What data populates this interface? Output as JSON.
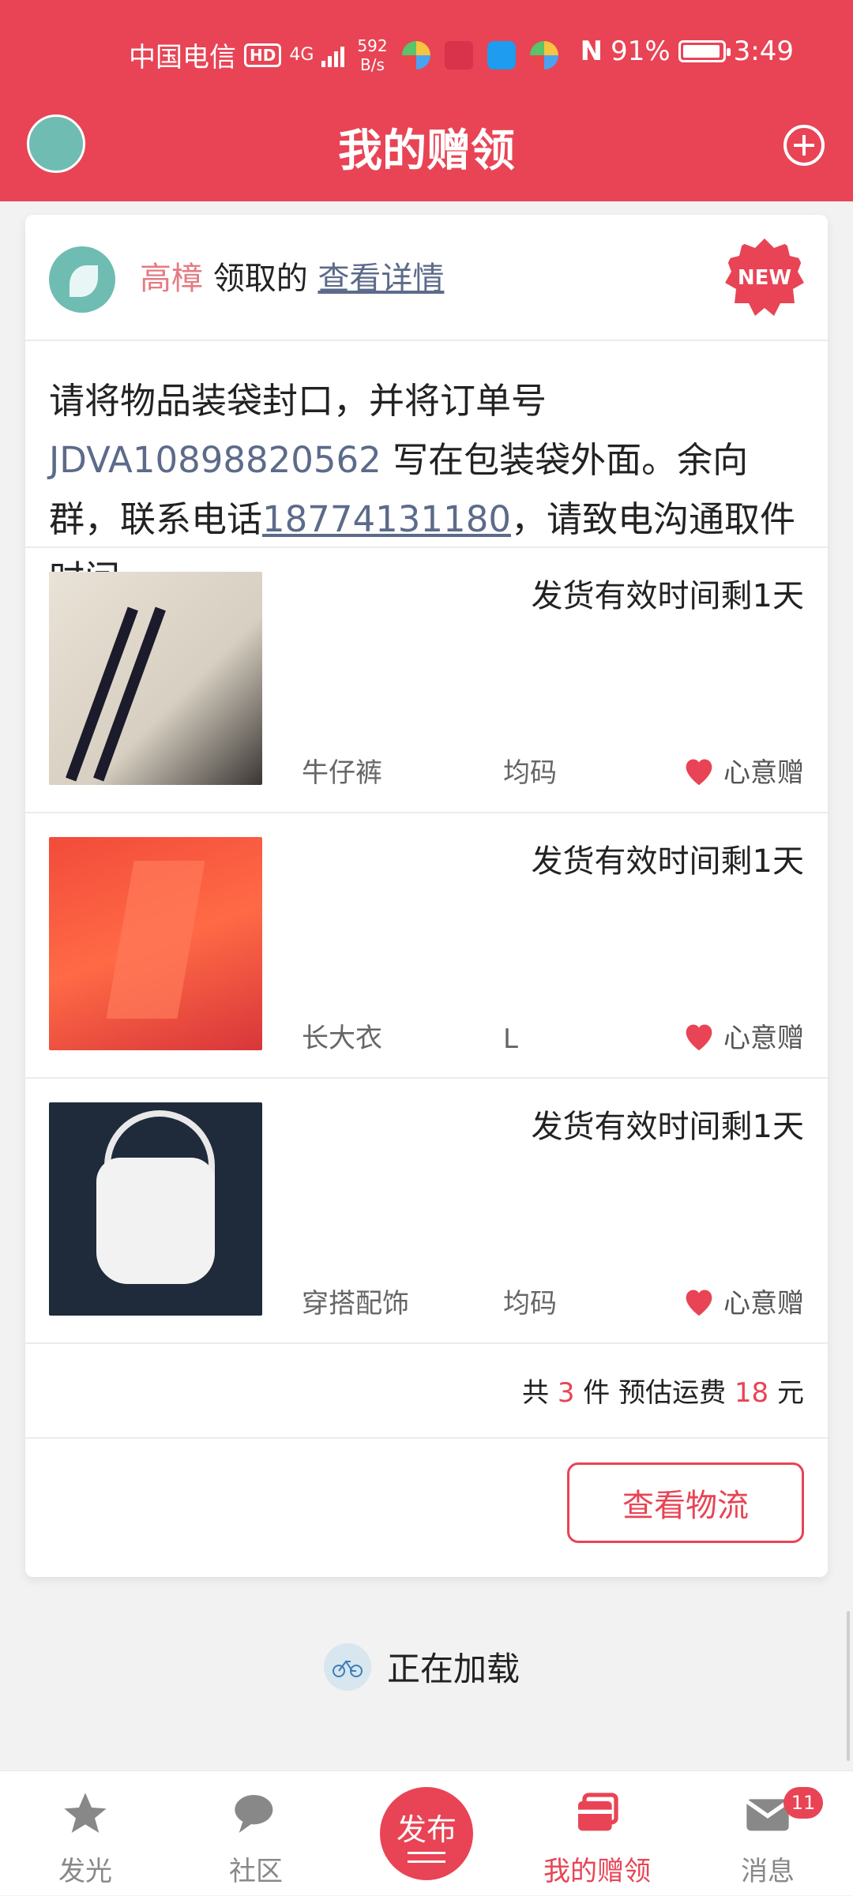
{
  "statusbar": {
    "carrier": "中国电信",
    "hd": "HD",
    "net": "4G",
    "speed_top": "592",
    "speed_bottom": "B/s",
    "battery": "91%",
    "time": "3:49"
  },
  "nav": {
    "title": "我的赠领"
  },
  "card": {
    "header": {
      "name": "高樟",
      "action": "领取的",
      "detail_link": "查看详情",
      "badge": "NEW"
    },
    "instruction": {
      "part1": "请将物品装袋封口，并将订单号 ",
      "order": "JDVA10898820562",
      "part2": " 写在包装袋外面。余向群，联系电话",
      "phone": "18774131180",
      "part3": "，请致电沟通取件时间。"
    },
    "items": [
      {
        "deadline": "发货有效时间剩1天",
        "name": "牛仔裤",
        "size": "均码",
        "type": "心意赠"
      },
      {
        "deadline": "发货有效时间剩1天",
        "name": "长大衣",
        "size": "L",
        "type": "心意赠"
      },
      {
        "deadline": "发货有效时间剩1天",
        "name": "穿搭配饰",
        "size": "均码",
        "type": "心意赠"
      }
    ],
    "summary": {
      "prefix": "共 ",
      "count": "3",
      "mid": " 件 预估运费 ",
      "fee": "18",
      "suffix": " 元"
    },
    "logistics_button": "查看物流"
  },
  "loading": {
    "text": "正在加载"
  },
  "tabbar": {
    "tabs": [
      {
        "label": "发光"
      },
      {
        "label": "社区"
      },
      {
        "label": "发布"
      },
      {
        "label": "我的赠领"
      },
      {
        "label": "消息"
      }
    ],
    "message_badge": "11",
    "active_color": "#e84455"
  },
  "colors": {
    "primary": "#e84455",
    "link": "#5d6b8a",
    "name": "#e57b84"
  }
}
